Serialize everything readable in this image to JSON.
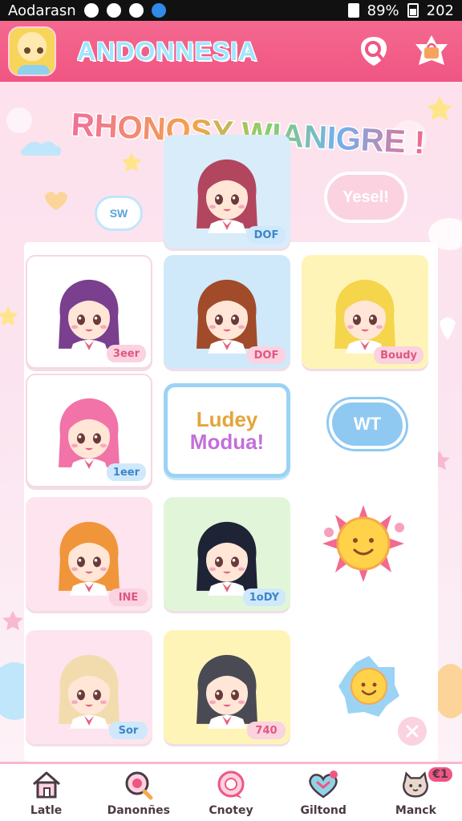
{
  "status_bar": {
    "carrier": "Aodarasn",
    "battery": "89%",
    "time": "202"
  },
  "app": {
    "title": "ANDONNESIA",
    "banner": "RHONOSY WIANIGRE !"
  },
  "header_icons": [
    "search-icon",
    "cart-icon"
  ],
  "bubbles": {
    "left": "SW",
    "right": "Yesel!",
    "cloud": "WT"
  },
  "cards": [
    {
      "tag": "DOF",
      "tag_style": "blue",
      "bg": "#d9ecfa",
      "hair": "#b2465e"
    },
    {
      "tag": "3eer",
      "tag_style": "pink",
      "bg": "#ffffff",
      "hair": "#7a3f8e"
    },
    {
      "tag": "DOF",
      "tag_style": "pink",
      "bg": "#cfe9fb",
      "hair": "#a14b2a"
    },
    {
      "tag": "Boudy",
      "tag_style": "pink",
      "bg": "#fff4b8",
      "hair": "#f5d54b"
    },
    {
      "tag": "1eer",
      "tag_style": "blue",
      "bg": "#ffffff",
      "hair": "#f173a8"
    },
    {
      "tag": "INE",
      "tag_style": "pink",
      "bg": "#fde4ee",
      "hair": "#f0953a"
    },
    {
      "tag": "1oDY",
      "tag_style": "blue",
      "bg": "#e1f6d9",
      "hair": "#1f2336"
    },
    {
      "tag": "Sor",
      "tag_style": "blue",
      "bg": "#fde4ee",
      "hair": "#f2dcae"
    },
    {
      "tag": "740",
      "tag_style": "pink",
      "bg": "#fff4b8",
      "hair": "#4a4a55"
    }
  ],
  "promo": {
    "line1": "Ludey",
    "line2": "Modua!"
  },
  "bottom_nav": [
    {
      "label": "Latle",
      "icon": "home-icon"
    },
    {
      "label": "Danonñes",
      "icon": "search-magnifier-icon"
    },
    {
      "label": "Cnotey",
      "icon": "chat-icon"
    },
    {
      "label": "Giltond",
      "icon": "heart-gift-icon"
    },
    {
      "label": "Manck",
      "icon": "cat-profile-icon",
      "badge": "€1"
    }
  ],
  "colors": {
    "header": "#f05583",
    "accent_pink": "#f4698f",
    "accent_blue": "#9bd3f5"
  }
}
